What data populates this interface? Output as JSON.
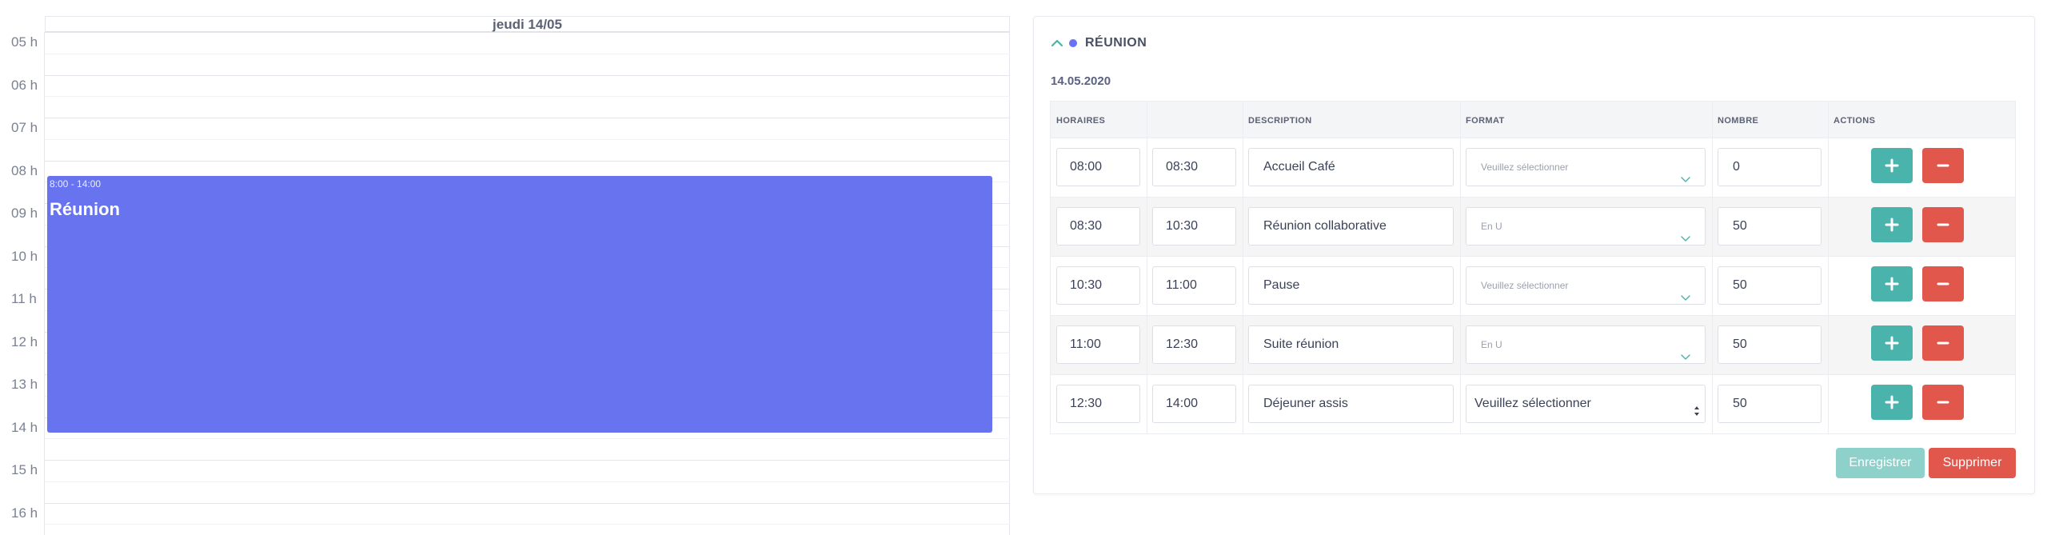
{
  "calendar": {
    "day_header": "jeudi 14/05",
    "hours": [
      "05 h",
      "06 h",
      "07 h",
      "08 h",
      "09 h",
      "10 h",
      "11 h",
      "12 h",
      "13 h",
      "14 h",
      "15 h",
      "16 h"
    ],
    "event": {
      "time": "8:00 - 14:00",
      "title": "Réunion",
      "color": "#6773ef"
    }
  },
  "panel": {
    "title": "RÉUNION",
    "date": "14.05.2020",
    "columns": {
      "horaires": "HORAIRES",
      "description": "DESCRIPTION",
      "format": "FORMAT",
      "nombre": "NOMBRE",
      "actions": "ACTIONS"
    },
    "rows": [
      {
        "start": "08:00",
        "end": "08:30",
        "description": "Accueil Café",
        "format": "Veuillez sélectionner",
        "nombre": "0"
      },
      {
        "start": "08:30",
        "end": "10:30",
        "description": "Réunion collaborative",
        "format": "En U",
        "nombre": "50"
      },
      {
        "start": "10:30",
        "end": "11:00",
        "description": "Pause",
        "format": "Veuillez sélectionner",
        "nombre": "50"
      },
      {
        "start": "11:00",
        "end": "12:30",
        "description": "Suite réunion",
        "format": "En U",
        "nombre": "50"
      },
      {
        "start": "12:30",
        "end": "14:00",
        "description": "Déjeuner assis",
        "format": "Veuillez sélectionner",
        "nombre": "50"
      }
    ],
    "buttons": {
      "save": "Enregistrer",
      "delete": "Supprimer"
    },
    "colors": {
      "accent_teal": "#4ab3ab",
      "danger_red": "#e2574c",
      "event_blue": "#6773ef"
    }
  }
}
